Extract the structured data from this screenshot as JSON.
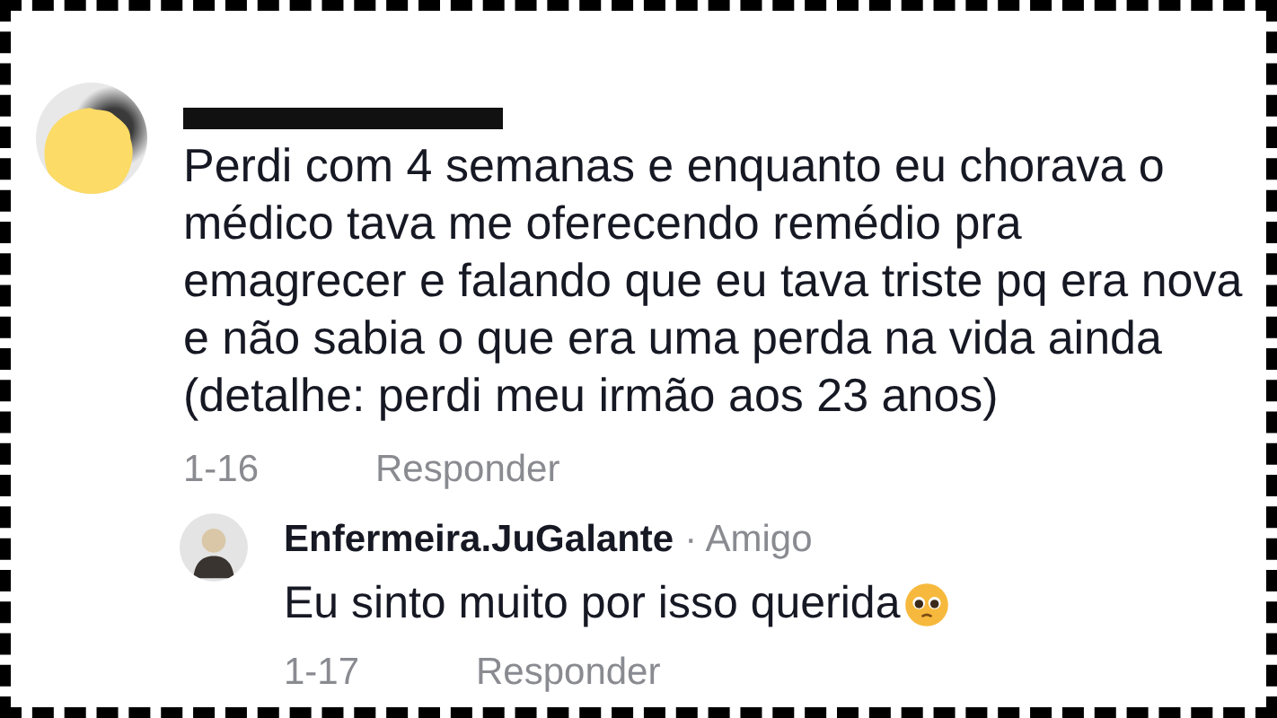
{
  "comment": {
    "name_redacted": true,
    "text_lines": [
      "Perdi com 4 semanas e enquanto eu chorava o",
      "médico tava me oferecendo remédio pra",
      "emagrecer e falando que eu tava triste pq era nova",
      "e não sabia o que era uma perda na vida ainda",
      "(detalhe: perdi meu irmão aos 23 anos)"
    ],
    "date": "1-16",
    "reply_label": "Responder"
  },
  "reply": {
    "username": "Enfermeira.JuGalante",
    "separator": "·",
    "relation": "Amigo",
    "text": "Eu sinto muito por isso querida",
    "date": "1-17",
    "reply_label": "Responder"
  }
}
